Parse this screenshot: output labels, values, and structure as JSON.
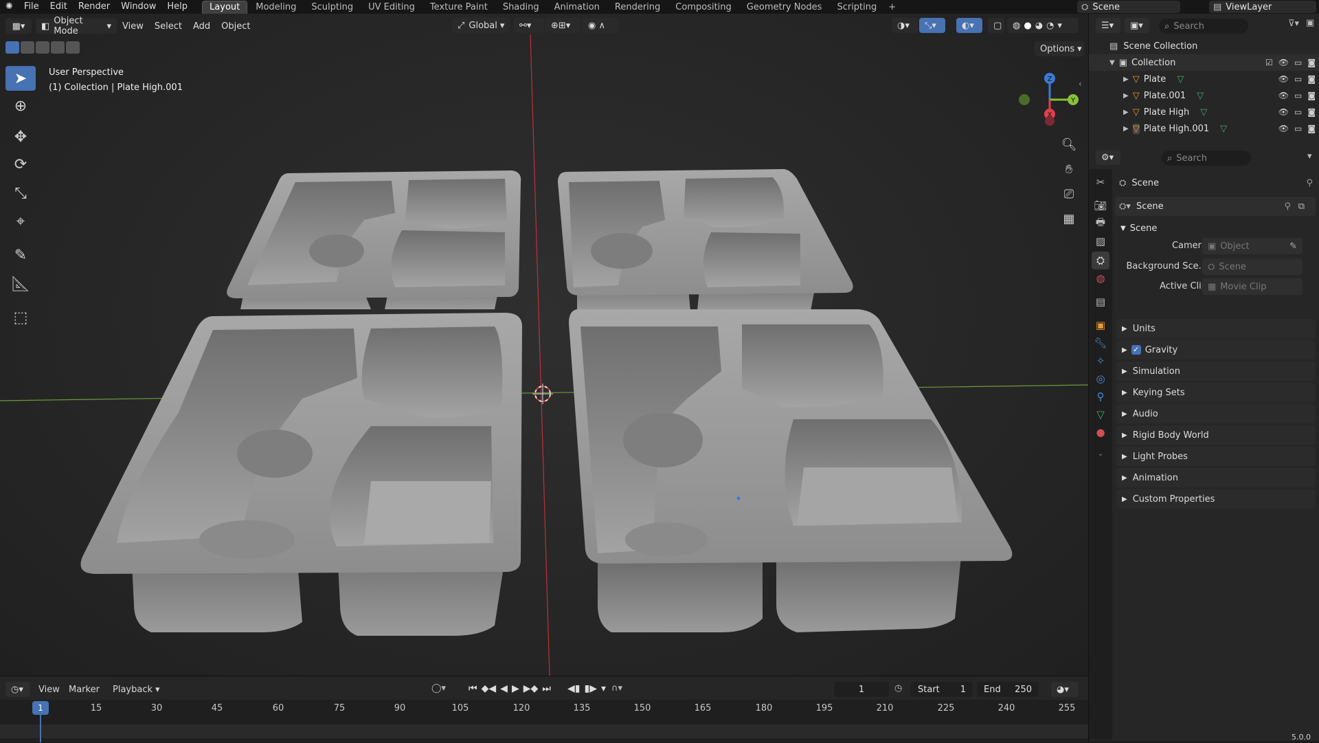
{
  "menubar": {
    "items": [
      "File",
      "Edit",
      "Render",
      "Window",
      "Help"
    ],
    "workspaces": [
      "Layout",
      "Modeling",
      "Sculpting",
      "UV Editing",
      "Texture Paint",
      "Shading",
      "Animation",
      "Rendering",
      "Compositing",
      "Geometry Nodes",
      "Scripting"
    ],
    "active_workspace": "Layout",
    "add_workspace": "+",
    "scene_name": "Scene",
    "view_layer": "ViewLayer"
  },
  "viewport": {
    "mode": "Object Mode",
    "menus": [
      "View",
      "Select",
      "Add",
      "Object"
    ],
    "transform_orientation": "Global",
    "options_label": "Options",
    "perspective_label": "User Perspective",
    "collection_label": "(1) Collection | Plate High.001",
    "gizmo_axes": {
      "x": "X",
      "y": "Y",
      "z": "Z"
    },
    "tools": [
      "cursor-select-icon",
      "cursor-icon",
      "move-icon",
      "rotate-icon",
      "scale-icon",
      "transform-icon",
      "annotate-icon",
      "measure-icon",
      "add-cube-icon"
    ]
  },
  "outliner": {
    "search_placeholder": "Search",
    "scene_collection": "Scene Collection",
    "collection": "Collection",
    "objects": [
      "Plate",
      "Plate.001",
      "Plate High",
      "Plate High.001"
    ]
  },
  "properties": {
    "search_placeholder": "Search",
    "context_label": "Scene",
    "datablock_name": "Scene",
    "panel_title": "Scene",
    "camera_label": "Camera",
    "camera_value": "Object",
    "background_label": "Background Sce...",
    "background_value": "Scene",
    "active_clip_label": "Active Clip",
    "active_clip_value": "Movie Clip",
    "sections": [
      "Units",
      "Gravity",
      "Simulation",
      "Keying Sets",
      "Audio",
      "Rigid Body World",
      "Light Probes",
      "Animation",
      "Custom Properties"
    ],
    "gravity_checked": true
  },
  "timeline": {
    "menus": [
      "View",
      "Marker",
      "Playback"
    ],
    "current_frame": "1",
    "start_label": "Start",
    "start_value": "1",
    "end_label": "End",
    "end_value": "250",
    "ruler": [
      "15",
      "30",
      "45",
      "60",
      "75",
      "90",
      "105",
      "120",
      "135",
      "150",
      "165",
      "180",
      "195",
      "210",
      "225",
      "240",
      "255"
    ],
    "playhead_label": "1"
  },
  "status": {
    "version": "5.0.0"
  },
  "colors": {
    "accent": "#4772b3",
    "x_axis": "#e0404f",
    "y_axis": "#86c23a",
    "z_axis": "#3b7bd4"
  }
}
